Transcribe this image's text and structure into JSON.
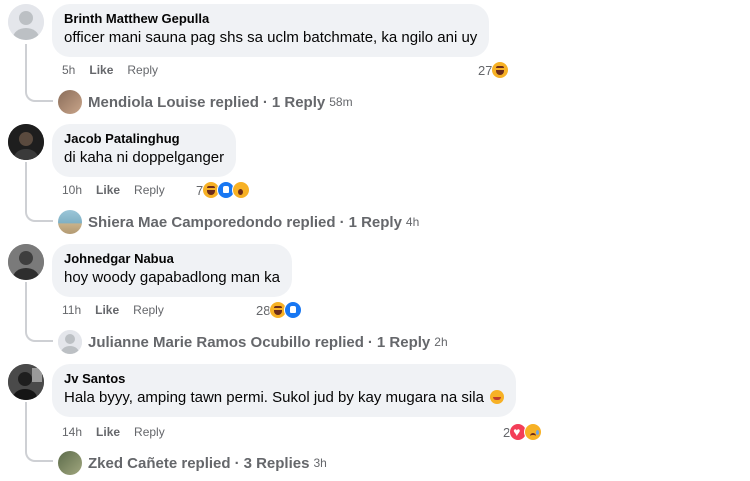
{
  "comments": [
    {
      "author": "Brinth Matthew Gepulla",
      "text": "officer mani sauna pag shs sa uclm batchmate, ka ngilo ani uy",
      "time": "5h",
      "like_label": "Like",
      "reply_label": "Reply",
      "reaction_count": "27",
      "reactions": [
        "haha"
      ],
      "replies": {
        "name": "Mendiola Louise",
        "action": "replied",
        "count": "1 Reply",
        "time": "58m"
      }
    },
    {
      "author": "Jacob Patalinghug",
      "text": "di kaha ni doppelganger",
      "time": "10h",
      "like_label": "Like",
      "reply_label": "Reply",
      "reaction_count": "7",
      "reactions": [
        "haha",
        "like",
        "wow"
      ],
      "replies": {
        "name": "Shiera Mae Camporedondo",
        "action": "replied",
        "count": "1 Reply",
        "time": "4h"
      }
    },
    {
      "author": "Johnedgar Nabua",
      "text": "hoy woody gapabadlong man ka",
      "time": "11h",
      "like_label": "Like",
      "reply_label": "Reply",
      "reaction_count": "28",
      "reactions": [
        "haha",
        "like"
      ],
      "replies": {
        "name": "Julianne Marie Ramos Ocubillo",
        "action": "replied",
        "count": "1 Reply",
        "time": "2h"
      }
    },
    {
      "author": "Jv Santos",
      "text": "Hala byyy, amping tawn permi. Sukol jud by kay mugara na sila",
      "text_emoji": "angry-face-emoji",
      "time": "14h",
      "like_label": "Like",
      "reply_label": "Reply",
      "reaction_count": "2",
      "reactions": [
        "love",
        "sad"
      ],
      "replies": {
        "name": "Zked Cañete",
        "action": "replied",
        "count": "3 Replies",
        "time": "3h"
      }
    }
  ],
  "separator": "·",
  "colors": {
    "bubble": "#f0f2f5",
    "meta": "#65676b",
    "like_blue": "#1877f2",
    "love_red": "#f33e58",
    "emoji_yellow": "#f7b125"
  }
}
